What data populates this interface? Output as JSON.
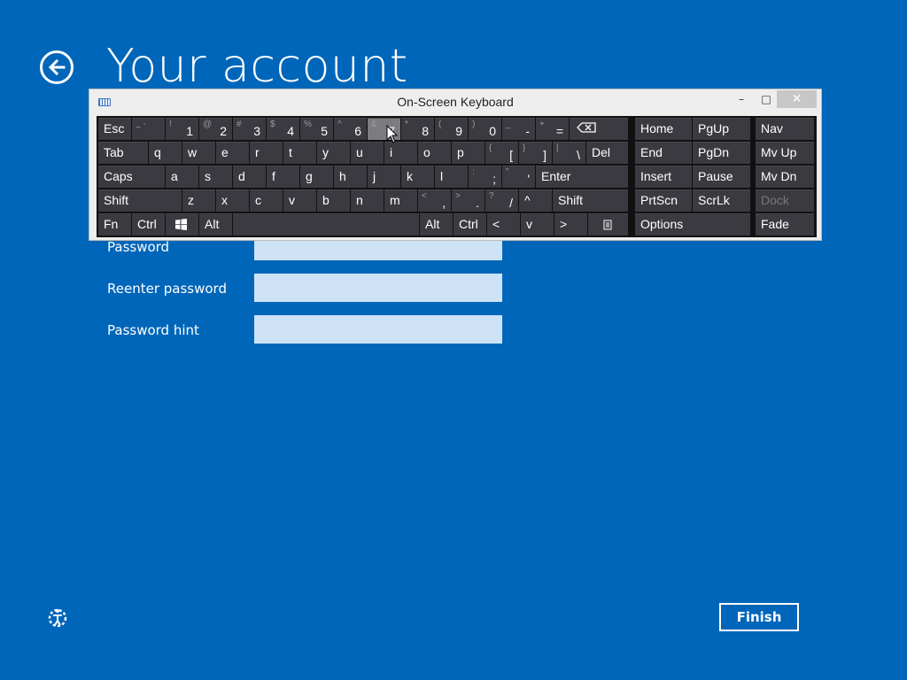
{
  "page": {
    "title": "Your account",
    "fields": [
      {
        "label": "Password",
        "value": "",
        "placeholder": ""
      },
      {
        "label": "Reenter password",
        "value": "",
        "placeholder": ""
      },
      {
        "label": "Password hint",
        "value": "",
        "placeholder": ""
      }
    ],
    "finish_label": "Finish",
    "back_icon": "back-arrow-icon",
    "ease_of_access_icon": "ease-of-access-icon"
  },
  "osk": {
    "title": "On-Screen Keyboard",
    "controls": {
      "minimize": "–",
      "maximize": "□",
      "close": "✕"
    },
    "keys": {
      "esc": "Esc",
      "k_tilde": "~ `",
      "k1": "1",
      "k2": "2",
      "k3": "3",
      "k4": "4",
      "k5": "5",
      "k6": "6",
      "k7": "7",
      "k8": "8",
      "k9": "9",
      "k0": "0",
      "kminus": "-",
      "kequal": "=",
      "s1": "!",
      "s2": "@",
      "s3": "#",
      "s4": "$",
      "s5": "%",
      "s6": "^",
      "s7": "&",
      "s8": "*",
      "s9": "(",
      "s0": ")",
      "sminus": "_",
      "sequal": "+",
      "home": "Home",
      "pgup": "PgUp",
      "nav": "Nav",
      "tab": "Tab",
      "q": "q",
      "w": "w",
      "e": "e",
      "r": "r",
      "t": "t",
      "y": "y",
      "u": "u",
      "i": "i",
      "o": "o",
      "p": "p",
      "lbr": "[",
      "rbr": "]",
      "bslash": "\\",
      "del": "Del",
      "slbr": "{",
      "srbr": "}",
      "sbslash": "|",
      "end": "End",
      "pgdn": "PgDn",
      "mvup": "Mv Up",
      "caps": "Caps",
      "a": "a",
      "s": "s",
      "d": "d",
      "f": "f",
      "g": "g",
      "h": "h",
      "j": "j",
      "k": "k",
      "l": "l",
      "semi": ";",
      "quote": "'",
      "ssemi": ":",
      "squote": "\"",
      "enter": "Enter",
      "insert": "Insert",
      "pause": "Pause",
      "mvdn": "Mv Dn",
      "shift": "Shift",
      "z": "z",
      "x": "x",
      "c": "c",
      "v": "v",
      "b": "b",
      "n": "n",
      "m": "m",
      "comma": ",",
      "period": ".",
      "slash": "/",
      "scomma": "<",
      "speriod": ">",
      "sslash": "?",
      "up": "^",
      "shift_r": "Shift",
      "prtscn": "PrtScn",
      "scrlk": "ScrLk",
      "dock": "Dock",
      "fn": "Fn",
      "ctrl": "Ctrl",
      "alt": "Alt",
      "alt_r": "Alt",
      "ctrl_r": "Ctrl",
      "left": "<",
      "down": "v",
      "right": ">",
      "options": "Options",
      "fade": "Fade"
    }
  }
}
